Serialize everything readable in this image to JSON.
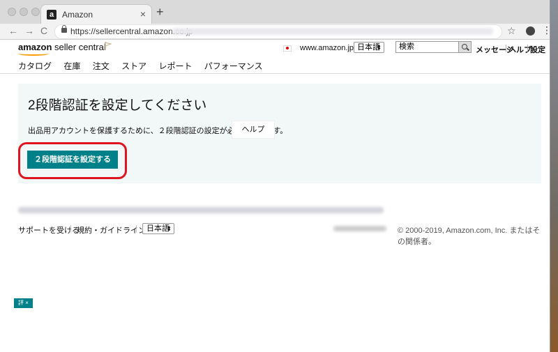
{
  "browser": {
    "tab_title": "Amazon",
    "favicon_letter": "a",
    "tab_close": "×",
    "new_tab": "+",
    "back": "←",
    "forward": "→",
    "reload": "C",
    "url": "https://sellercentral.amazon.co.jp",
    "star": "☆",
    "menu": "⋮"
  },
  "header": {
    "logo_brand": "amazon",
    "logo_product": "seller central",
    "marketplace": "www.amazon.jp",
    "language": "日本語",
    "select_arrow": "⬍",
    "search_placeholder": "検索",
    "links": [
      "メッセージ",
      "ヘルプ",
      "設定"
    ],
    "separator": "|",
    "accent_color": "#ff9900"
  },
  "nav": {
    "items": [
      "カタログ",
      "在庫",
      "注文",
      "ストア",
      "レポート",
      "パフォーマンス"
    ]
  },
  "card": {
    "title": "2段階認証を設定してください",
    "text": "出品用アカウントを保護するために、２段階認証の設定が必須となります。",
    "help_button": "ヘルプ",
    "primary_button": "２段階認証を設定する",
    "primary_color": "#00818a",
    "highlight_color": "#e0141e"
  },
  "footer": {
    "support": "サポートを受ける",
    "terms": "規約・ガイドライン",
    "language": "日本語",
    "copyright": "© 2000-2019, Amazon.com, Inc. またはその関係者。"
  },
  "feedback": {
    "label": "評 ×"
  }
}
